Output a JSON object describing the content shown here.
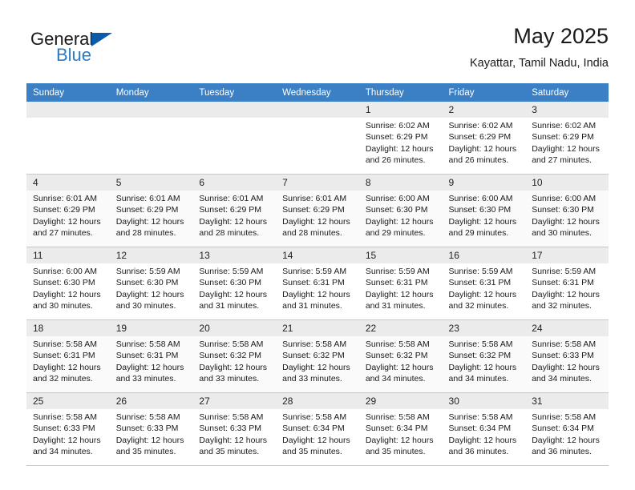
{
  "brand": {
    "name_part1": "General",
    "name_part2": "Blue",
    "logo_icon": "triangle-flag-icon"
  },
  "header": {
    "title": "May 2025",
    "subtitle": "Kayattar, Tamil Nadu, India"
  },
  "calendar": {
    "weekday_headers": [
      "Sunday",
      "Monday",
      "Tuesday",
      "Wednesday",
      "Thursday",
      "Friday",
      "Saturday"
    ],
    "accent_color": "#3b7fc4",
    "header_text_color": "#ffffff",
    "daynum_bg_color": "#ebebeb",
    "weeks": [
      [
        {
          "day": "",
          "empty": true
        },
        {
          "day": "",
          "empty": true
        },
        {
          "day": "",
          "empty": true
        },
        {
          "day": "",
          "empty": true
        },
        {
          "day": "1",
          "sunrise": "Sunrise: 6:02 AM",
          "sunset": "Sunset: 6:29 PM",
          "daylight1": "Daylight: 12 hours",
          "daylight2": "and 26 minutes."
        },
        {
          "day": "2",
          "sunrise": "Sunrise: 6:02 AM",
          "sunset": "Sunset: 6:29 PM",
          "daylight1": "Daylight: 12 hours",
          "daylight2": "and 26 minutes."
        },
        {
          "day": "3",
          "sunrise": "Sunrise: 6:02 AM",
          "sunset": "Sunset: 6:29 PM",
          "daylight1": "Daylight: 12 hours",
          "daylight2": "and 27 minutes."
        }
      ],
      [
        {
          "day": "4",
          "sunrise": "Sunrise: 6:01 AM",
          "sunset": "Sunset: 6:29 PM",
          "daylight1": "Daylight: 12 hours",
          "daylight2": "and 27 minutes."
        },
        {
          "day": "5",
          "sunrise": "Sunrise: 6:01 AM",
          "sunset": "Sunset: 6:29 PM",
          "daylight1": "Daylight: 12 hours",
          "daylight2": "and 28 minutes."
        },
        {
          "day": "6",
          "sunrise": "Sunrise: 6:01 AM",
          "sunset": "Sunset: 6:29 PM",
          "daylight1": "Daylight: 12 hours",
          "daylight2": "and 28 minutes."
        },
        {
          "day": "7",
          "sunrise": "Sunrise: 6:01 AM",
          "sunset": "Sunset: 6:29 PM",
          "daylight1": "Daylight: 12 hours",
          "daylight2": "and 28 minutes."
        },
        {
          "day": "8",
          "sunrise": "Sunrise: 6:00 AM",
          "sunset": "Sunset: 6:30 PM",
          "daylight1": "Daylight: 12 hours",
          "daylight2": "and 29 minutes."
        },
        {
          "day": "9",
          "sunrise": "Sunrise: 6:00 AM",
          "sunset": "Sunset: 6:30 PM",
          "daylight1": "Daylight: 12 hours",
          "daylight2": "and 29 minutes."
        },
        {
          "day": "10",
          "sunrise": "Sunrise: 6:00 AM",
          "sunset": "Sunset: 6:30 PM",
          "daylight1": "Daylight: 12 hours",
          "daylight2": "and 30 minutes."
        }
      ],
      [
        {
          "day": "11",
          "sunrise": "Sunrise: 6:00 AM",
          "sunset": "Sunset: 6:30 PM",
          "daylight1": "Daylight: 12 hours",
          "daylight2": "and 30 minutes."
        },
        {
          "day": "12",
          "sunrise": "Sunrise: 5:59 AM",
          "sunset": "Sunset: 6:30 PM",
          "daylight1": "Daylight: 12 hours",
          "daylight2": "and 30 minutes."
        },
        {
          "day": "13",
          "sunrise": "Sunrise: 5:59 AM",
          "sunset": "Sunset: 6:30 PM",
          "daylight1": "Daylight: 12 hours",
          "daylight2": "and 31 minutes."
        },
        {
          "day": "14",
          "sunrise": "Sunrise: 5:59 AM",
          "sunset": "Sunset: 6:31 PM",
          "daylight1": "Daylight: 12 hours",
          "daylight2": "and 31 minutes."
        },
        {
          "day": "15",
          "sunrise": "Sunrise: 5:59 AM",
          "sunset": "Sunset: 6:31 PM",
          "daylight1": "Daylight: 12 hours",
          "daylight2": "and 31 minutes."
        },
        {
          "day": "16",
          "sunrise": "Sunrise: 5:59 AM",
          "sunset": "Sunset: 6:31 PM",
          "daylight1": "Daylight: 12 hours",
          "daylight2": "and 32 minutes."
        },
        {
          "day": "17",
          "sunrise": "Sunrise: 5:59 AM",
          "sunset": "Sunset: 6:31 PM",
          "daylight1": "Daylight: 12 hours",
          "daylight2": "and 32 minutes."
        }
      ],
      [
        {
          "day": "18",
          "sunrise": "Sunrise: 5:58 AM",
          "sunset": "Sunset: 6:31 PM",
          "daylight1": "Daylight: 12 hours",
          "daylight2": "and 32 minutes."
        },
        {
          "day": "19",
          "sunrise": "Sunrise: 5:58 AM",
          "sunset": "Sunset: 6:31 PM",
          "daylight1": "Daylight: 12 hours",
          "daylight2": "and 33 minutes."
        },
        {
          "day": "20",
          "sunrise": "Sunrise: 5:58 AM",
          "sunset": "Sunset: 6:32 PM",
          "daylight1": "Daylight: 12 hours",
          "daylight2": "and 33 minutes."
        },
        {
          "day": "21",
          "sunrise": "Sunrise: 5:58 AM",
          "sunset": "Sunset: 6:32 PM",
          "daylight1": "Daylight: 12 hours",
          "daylight2": "and 33 minutes."
        },
        {
          "day": "22",
          "sunrise": "Sunrise: 5:58 AM",
          "sunset": "Sunset: 6:32 PM",
          "daylight1": "Daylight: 12 hours",
          "daylight2": "and 34 minutes."
        },
        {
          "day": "23",
          "sunrise": "Sunrise: 5:58 AM",
          "sunset": "Sunset: 6:32 PM",
          "daylight1": "Daylight: 12 hours",
          "daylight2": "and 34 minutes."
        },
        {
          "day": "24",
          "sunrise": "Sunrise: 5:58 AM",
          "sunset": "Sunset: 6:33 PM",
          "daylight1": "Daylight: 12 hours",
          "daylight2": "and 34 minutes."
        }
      ],
      [
        {
          "day": "25",
          "sunrise": "Sunrise: 5:58 AM",
          "sunset": "Sunset: 6:33 PM",
          "daylight1": "Daylight: 12 hours",
          "daylight2": "and 34 minutes."
        },
        {
          "day": "26",
          "sunrise": "Sunrise: 5:58 AM",
          "sunset": "Sunset: 6:33 PM",
          "daylight1": "Daylight: 12 hours",
          "daylight2": "and 35 minutes."
        },
        {
          "day": "27",
          "sunrise": "Sunrise: 5:58 AM",
          "sunset": "Sunset: 6:33 PM",
          "daylight1": "Daylight: 12 hours",
          "daylight2": "and 35 minutes."
        },
        {
          "day": "28",
          "sunrise": "Sunrise: 5:58 AM",
          "sunset": "Sunset: 6:34 PM",
          "daylight1": "Daylight: 12 hours",
          "daylight2": "and 35 minutes."
        },
        {
          "day": "29",
          "sunrise": "Sunrise: 5:58 AM",
          "sunset": "Sunset: 6:34 PM",
          "daylight1": "Daylight: 12 hours",
          "daylight2": "and 35 minutes."
        },
        {
          "day": "30",
          "sunrise": "Sunrise: 5:58 AM",
          "sunset": "Sunset: 6:34 PM",
          "daylight1": "Daylight: 12 hours",
          "daylight2": "and 36 minutes."
        },
        {
          "day": "31",
          "sunrise": "Sunrise: 5:58 AM",
          "sunset": "Sunset: 6:34 PM",
          "daylight1": "Daylight: 12 hours",
          "daylight2": "and 36 minutes."
        }
      ]
    ]
  }
}
